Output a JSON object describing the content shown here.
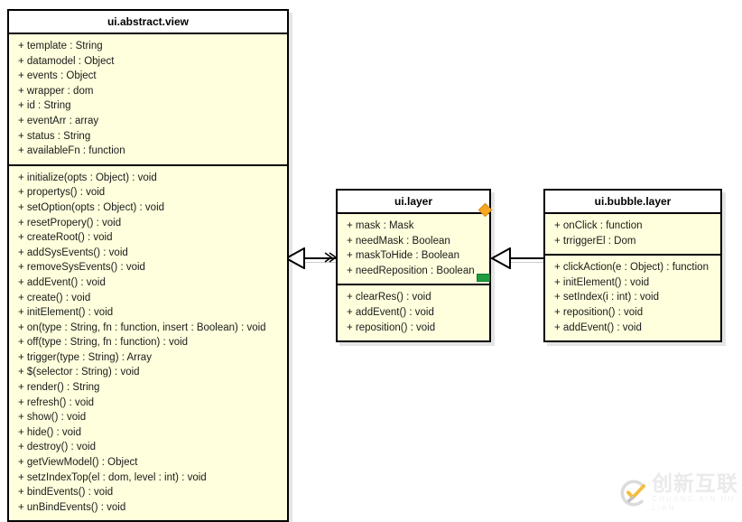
{
  "diagram": {
    "type": "uml-class-diagram",
    "background_color": "#ffffff",
    "class_fill_color": "#ffffdd",
    "class_header_color": "#ffffff",
    "border_color": "#000000"
  },
  "classes": [
    {
      "name": "ui.abstract.view",
      "attributes": [
        "+ template : String",
        "+ datamodel : Object",
        "+ events : Object",
        "+ wrapper : dom",
        "+ id : String",
        "+ eventArr : array",
        "+ status : String",
        "+ availableFn : function"
      ],
      "methods": [
        "+ initialize(opts : Object) : void",
        "+ propertys() : void",
        "+ setOption(opts : Object) : void",
        "+ resetPropery() : void",
        "+ createRoot() : void",
        "+ addSysEvents() : void",
        "+ removeSysEvents() : void",
        "+ addEvent() : void",
        "+ create() : void",
        "+ initElement() : void",
        "+ on(type : String, fn : function, insert : Boolean) : void",
        "+ off(type : String, fn : function) : void",
        "+ trigger(type : String) : Array",
        "+ $(selector : String) : void",
        "+ render() : String",
        "+ refresh() : void",
        "+ show() : void",
        "+ hide() : void",
        "+ destroy() : void",
        "+ getViewModel() : Object",
        "+ setzIndexTop(el : dom, level : int) : void",
        "+ bindEvents() : void",
        "+ unBindEvents() : void"
      ]
    },
    {
      "name": "ui.layer",
      "attributes": [
        "+ mask : Mask",
        "+ needMask : Boolean",
        "+ maskToHide : Boolean",
        "+ needReposition : Boolean"
      ],
      "methods": [
        "+ clearRes() : void",
        "+ addEvent() : void",
        "+ reposition() : void"
      ],
      "ports": [
        {
          "name": "required-interface-diamond",
          "color": "#f6a623",
          "shape": "diamond"
        },
        {
          "name": "provided-interface-square",
          "color": "#1f9c3f",
          "shape": "square"
        }
      ]
    },
    {
      "name": "ui.bubble.layer",
      "attributes": [
        "+ onClick : function",
        "+ trriggerEl : Dom"
      ],
      "methods": [
        "+ clickAction(e : Object) : function",
        "+ initElement() : void",
        "+ setIndex(i : int) : void",
        "+ reposition() : void",
        "+ addEvent() : void"
      ]
    }
  ],
  "relations": [
    {
      "name": "generalization-layer-to-view",
      "from": "ui.layer",
      "to": "ui.abstract.view",
      "kind": "generalization"
    },
    {
      "name": "generalization-bubble-to-layer",
      "from": "ui.bubble.layer",
      "to": "ui.layer",
      "kind": "generalization"
    }
  ],
  "watermark": {
    "chinese": "创新互联",
    "pinyin": "CHUANG XIN HU LIAN",
    "logo_letter": "CX",
    "accent_color": "#f5b731"
  }
}
